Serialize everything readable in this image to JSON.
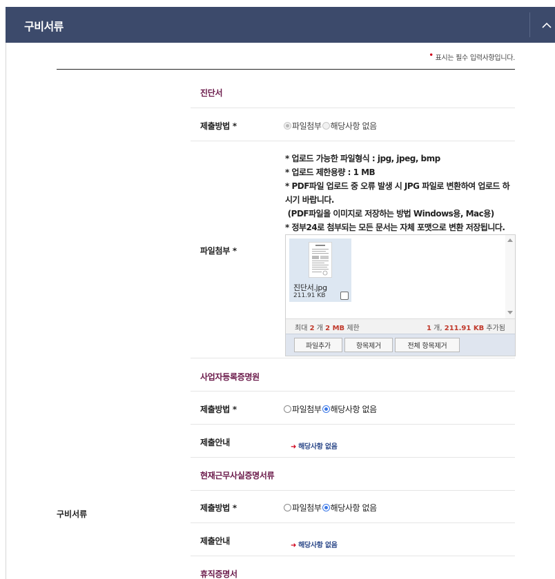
{
  "header": {
    "title": "구비서류"
  },
  "required_note": {
    "star": "•",
    "text": "표시는 필수 입력사항입니다."
  },
  "side_label": "구비서류",
  "sections": [
    {
      "title": "진단서",
      "method_label": "제출방법 *",
      "options": [
        "파일첨부",
        "해당사항 없음"
      ],
      "selected": "파일첨부",
      "attach_label": "파일첨부 *",
      "notes": [
        "* 업로드 가능한 파일형식 : jpg, jpeg, bmp",
        "* 업로드 제한용량 : 1 MB",
        "* PDF파일 업로드 중 오류 발생 시 JPG 파일로 변환하여 업로드 하",
        "시기 바랍니다.",
        " (PDF파일을 이미지로 저장하는 방법 Windows용, Mac용)",
        "* 정부24로 첨부되는 모든 문서는 자체 포맷으로 변환 저장됩니다."
      ],
      "uploader": {
        "file_name": "진단서.jpg",
        "file_size": "211.91 KB",
        "limit_prefix": "최대",
        "limit_count": "2",
        "limit_count_unit": "개",
        "limit_size": "2 MB",
        "limit_suffix": "제한",
        "added_count": "1",
        "added_count_unit": "개,",
        "added_size": "211.91 KB",
        "added_suffix": "추가됨",
        "buttons": [
          "파일추가",
          "항목제거",
          "전체 항목제거"
        ]
      }
    },
    {
      "title": "사업자등록증명원",
      "method_label": "제출방법 *",
      "options": [
        "파일첨부",
        "해당사항 없음"
      ],
      "selected": "해당사항 없음",
      "guide_label": "제출안내",
      "guide_text": "해당사항 없음"
    },
    {
      "title": "현재근무사실증명서류",
      "method_label": "제출방법 *",
      "options": [
        "파일첨부",
        "해당사항 없음"
      ],
      "selected": "해당사항 없음",
      "guide_label": "제출안내",
      "guide_text": "해당사항 없음"
    },
    {
      "title": "휴직증명서"
    }
  ],
  "icons": {
    "collapse": "chevron-up-icon",
    "guide_arrow": "arrow-right-icon"
  },
  "colors": {
    "header_bg": "#3c4a6b",
    "section_title": "#6b1a4a",
    "radio_checked": "#3b78e7",
    "highlight": "#c0392b"
  }
}
